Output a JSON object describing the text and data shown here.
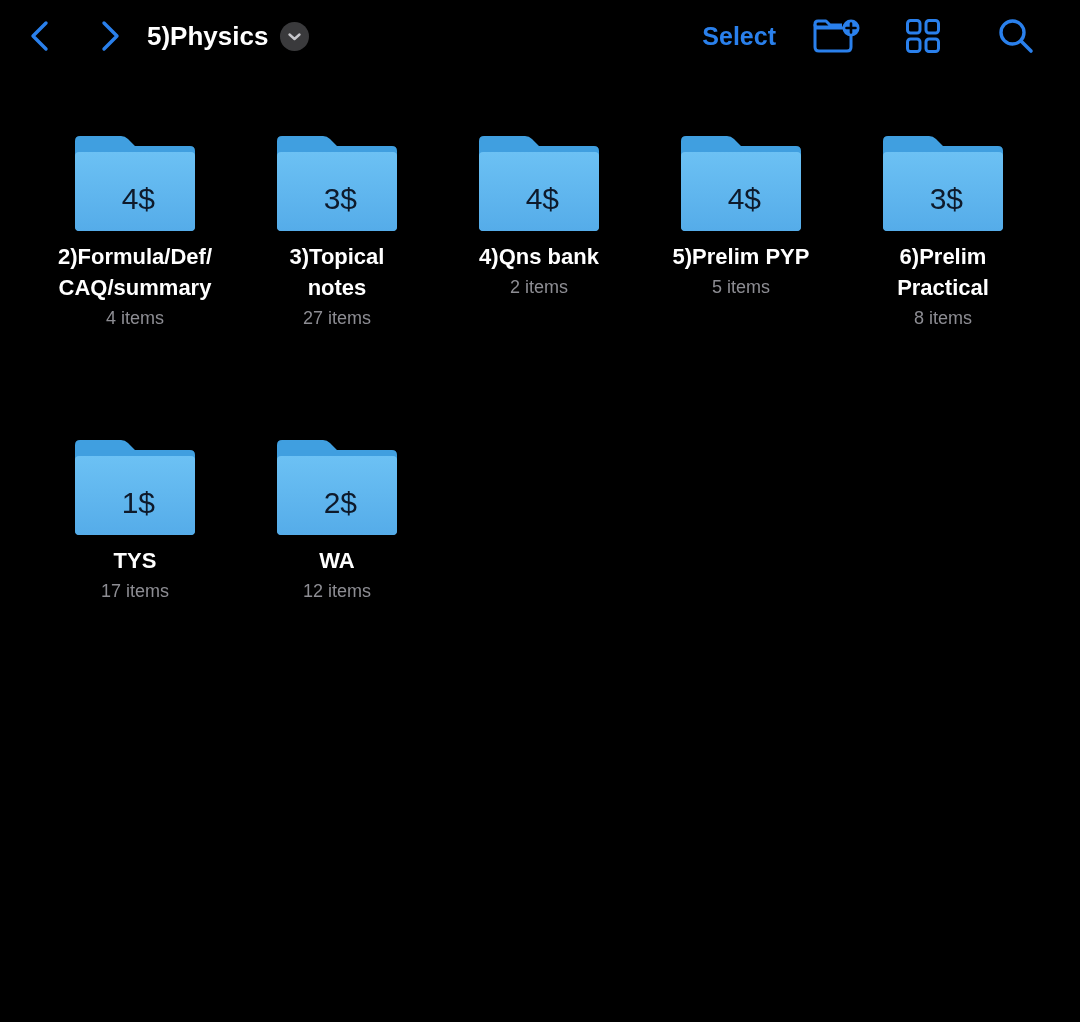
{
  "toolbar": {
    "title": "5)Physics",
    "action": "Select"
  },
  "folders": [
    {
      "name": "2)Formula/Def/\nCAQ/summary",
      "count": "4 items",
      "price": "4$"
    },
    {
      "name": "3)Topical\nnotes",
      "count": "27 items",
      "price": "3$"
    },
    {
      "name": "4)Qns bank",
      "count": "2 items",
      "price": "4$"
    },
    {
      "name": "5)Prelim PYP",
      "count": "5 items",
      "price": "4$"
    },
    {
      "name": "6)Prelim\nPractical",
      "count": "8 items",
      "price": "3$"
    },
    {
      "name": "TYS",
      "count": "17 items",
      "price": "1$"
    },
    {
      "name": "WA",
      "count": "12 items",
      "price": "2$"
    }
  ]
}
